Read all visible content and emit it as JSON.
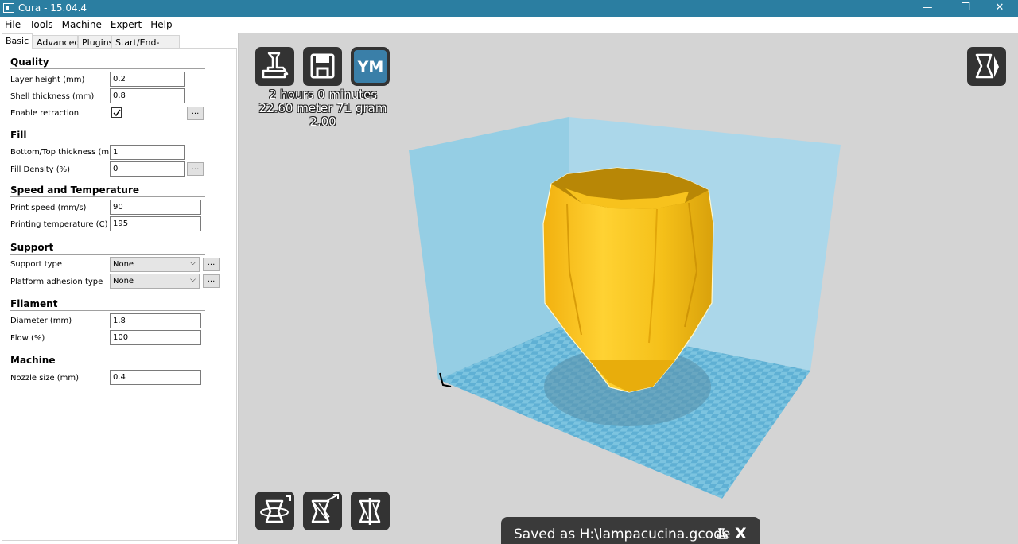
{
  "window": {
    "title": "Cura - 15.04.4",
    "minimize": "—",
    "restore": "❐",
    "close": "✕"
  },
  "menu": [
    "File",
    "Tools",
    "Machine",
    "Expert",
    "Help"
  ],
  "tabs": [
    "Basic",
    "Advanced",
    "Plugins",
    "Start/End-GCode"
  ],
  "quality": {
    "title": "Quality",
    "layer_height_label": "Layer height (mm)",
    "layer_height": "0.2",
    "shell_thickness_label": "Shell thickness (mm)",
    "shell_thickness": "0.8",
    "retraction_label": "Enable retraction",
    "retraction_checked": true,
    "more": "..."
  },
  "fill": {
    "title": "Fill",
    "bottom_top_label": "Bottom/Top thickness (mm)",
    "bottom_top": "1",
    "density_label": "Fill Density (%)",
    "density": "0",
    "more": "..."
  },
  "speed": {
    "title": "Speed and Temperature",
    "print_speed_label": "Print speed (mm/s)",
    "print_speed": "90",
    "temperature_label": "Printing temperature (C)",
    "temperature": "195"
  },
  "support": {
    "title": "Support",
    "type_label": "Support type",
    "type": "None",
    "adhesion_label": "Platform adhesion type",
    "adhesion": "None",
    "more": "..."
  },
  "filament": {
    "title": "Filament",
    "diameter_label": "Diameter (mm)",
    "diameter": "1.8",
    "flow_label": "Flow (%)",
    "flow": "100"
  },
  "machine": {
    "title": "Machine",
    "nozzle_label": "Nozzle size (mm)",
    "nozzle": "0.4"
  },
  "viewport": {
    "ym_label": "YM",
    "stats_time": "2 hours 0 minutes",
    "stats_material": "22.60 meter 71 gram",
    "stats_cost": "2.00",
    "toast_message": "Saved as H:\\lampacucina.gcode",
    "toast_close": "X"
  },
  "colors": {
    "titlebar": "#2b7ea1",
    "viewport_bg": "#d4d4d4",
    "build_volume": "#7ec8e3",
    "model": "#f5c019",
    "toolbar_button": "#333333"
  },
  "icons": [
    "load-icon",
    "save-icon",
    "ym-icon",
    "view-mode-icon",
    "rotate-icon",
    "scale-icon",
    "mirror-icon",
    "printer-icon"
  ]
}
